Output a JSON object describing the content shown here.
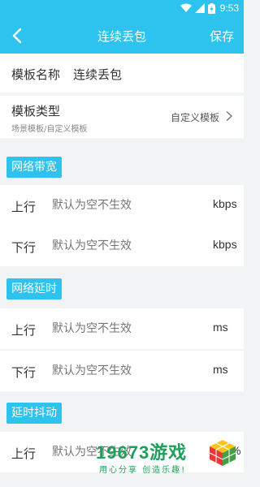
{
  "status": {
    "time": "9:53"
  },
  "header": {
    "title": "连续丢包",
    "save_label": "保存"
  },
  "template_name": {
    "label": "模板名称",
    "value": "连续丢包"
  },
  "template_type": {
    "label": "模板类型",
    "sub": "场景模板/自定义模板",
    "value": "自定义模板"
  },
  "sections": {
    "bandwidth": {
      "title": "网络带宽",
      "up": {
        "label": "上行",
        "placeholder": "默认为空不生效",
        "unit": "kbps"
      },
      "down": {
        "label": "下行",
        "placeholder": "默认为空不生效",
        "unit": "kbps"
      }
    },
    "latency": {
      "title": "网络延时",
      "up": {
        "label": "上行",
        "placeholder": "默认为空不生效",
        "unit": "ms"
      },
      "down": {
        "label": "下行",
        "placeholder": "默认为空不生效",
        "unit": "ms"
      }
    },
    "jitter": {
      "title": "延时抖动",
      "up": {
        "label": "上行",
        "placeholder": "默认为空不生效",
        "unit": "%"
      }
    }
  },
  "watermark": {
    "text": "19673游戏",
    "sub": "用心分享 创造乐趣!"
  },
  "colors": {
    "accent": "#2ec2ef",
    "watermark": "#1fa05a"
  }
}
